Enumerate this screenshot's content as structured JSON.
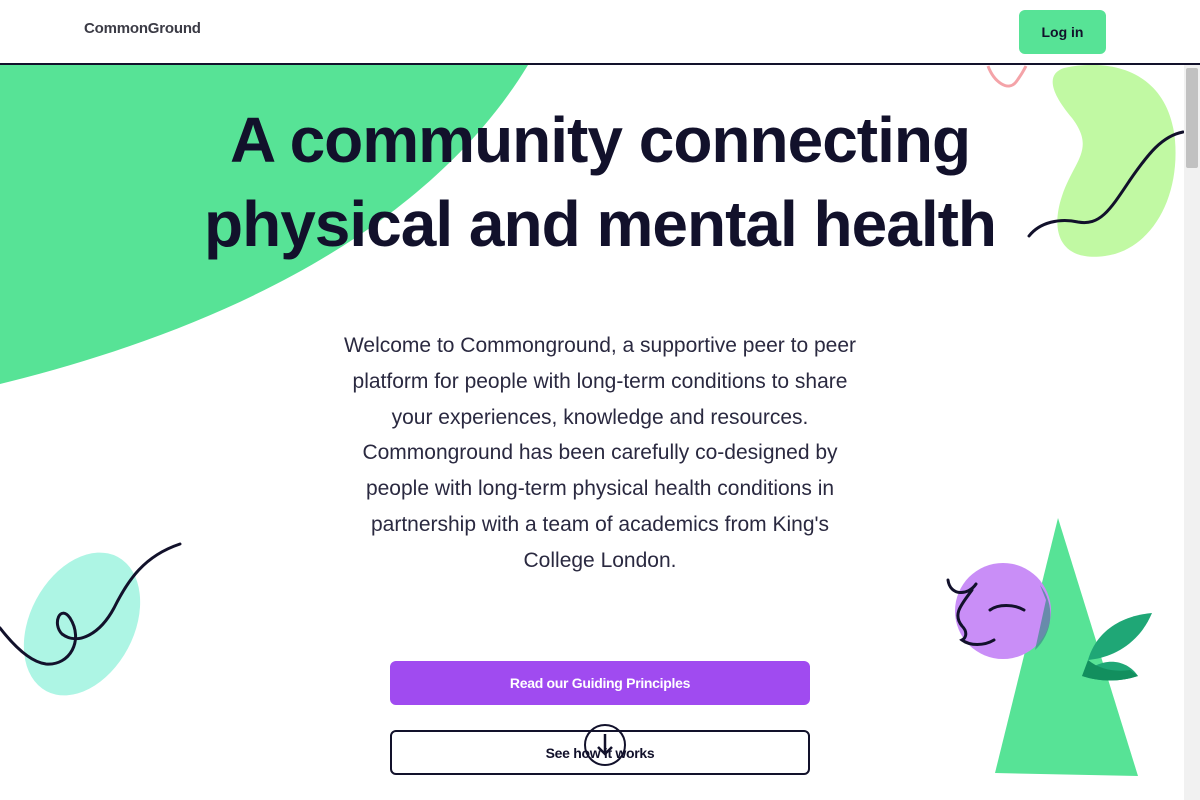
{
  "header": {
    "brand": "CommonGround",
    "login_label": "Log in"
  },
  "hero": {
    "title_line1": "A community connecting",
    "title_line2": "physical and mental health",
    "intro": "Welcome to Commonground, a supportive peer to peer platform for people with long-term conditions to share your experiences, knowledge and resources. Commonground has been carefully co-designed by people with long-term physical health conditions in partnership with a team of academics from King's College London.",
    "primary_button": "Read our Guiding Principles",
    "secondary_button": "See how it works"
  },
  "icons": {
    "scroll": "arrow-down-icon"
  },
  "colors": {
    "green": "#57e396",
    "lime": "#c1f9a3",
    "mint": "#adf5e4",
    "purple": "#a04bf0",
    "lilac": "#c98ef7",
    "dark": "#12112b",
    "leaf": "#1fa776"
  }
}
